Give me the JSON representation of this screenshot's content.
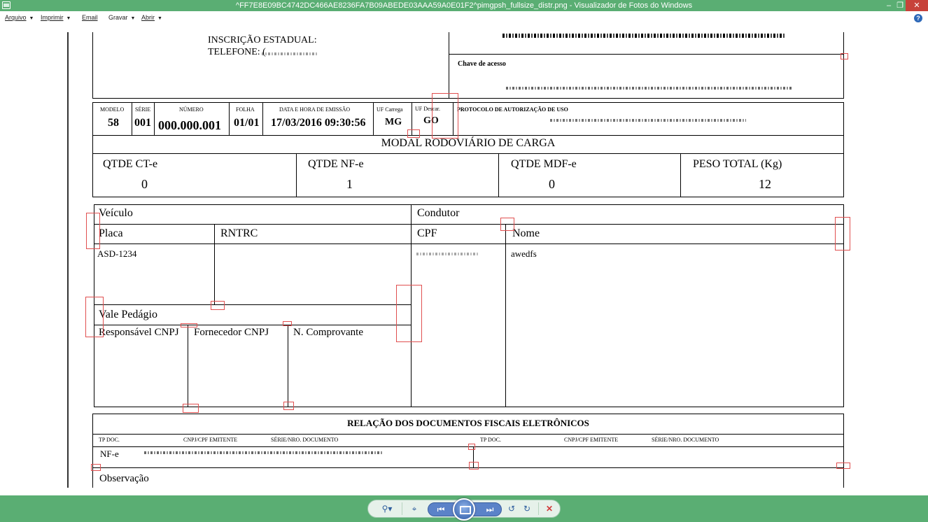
{
  "window": {
    "title": "^FF7E8E09BC4742DC466AE8236FA7B09ABEDE03AAA59A0E01F2^pimgpsh_fullsize_distr.png - Visualizador de Fotos do Windows",
    "minimize": "–",
    "restore": "❐",
    "close": "✕"
  },
  "menu": {
    "items": [
      {
        "label": "Arquivo",
        "has_dropdown": true
      },
      {
        "label": "Imprimir",
        "has_dropdown": true
      },
      {
        "label": "Email",
        "has_dropdown": false
      },
      {
        "label": "Gravar",
        "has_dropdown": true
      },
      {
        "label": "Abrir",
        "has_dropdown": true
      }
    ],
    "caret": "▼",
    "help": "?"
  },
  "document": {
    "header": {
      "inscricao": "INSCRIÇÃO ESTADUAL:",
      "telefone": "TELEFONE: (",
      "chave_label": "Chave de acesso",
      "protocolo_label": "PROTOCOLO DE AUTORIZAÇÃO DE USO"
    },
    "ids": {
      "modelo_label": "MODELO",
      "modelo": "58",
      "serie_label": "SÉRIE",
      "serie": "001",
      "numero_label": "NÚMERO",
      "numero": "000.000.001",
      "folha_label": "FOLHA",
      "folha": "01/01",
      "data_label": "DATA E HORA DE EMISSÃO",
      "data": "17/03/2016 09:30:56",
      "uf_carrega_label": "UF Carrega",
      "uf_carrega": "MG",
      "uf_descar_label": "UF Descar.",
      "uf_descar": "GO"
    },
    "modal_title": "MODAL RODOVIÁRIO DE CARGA",
    "totals": {
      "cte_label": "QTDE CT-e",
      "cte": "0",
      "nfe_label": "QTDE NF-e",
      "nfe": "1",
      "mdfe_label": "QTDE MDF-e",
      "mdfe": "0",
      "peso_label": "PESO TOTAL (Kg)",
      "peso": "12"
    },
    "veiculo": {
      "title": "Veículo",
      "placa_label": "Placa",
      "rntrc_label": "RNTRC",
      "placa": "ASD-1234"
    },
    "condutor": {
      "title": "Condutor",
      "cpf_label": "CPF",
      "nome_label": "Nome",
      "nome": "awedfs"
    },
    "vale": {
      "title": "Vale Pedágio",
      "resp_label": "Responsável CNPJ",
      "forn_label": "Fornecedor CNPJ",
      "comp_label": "N. Comprovante"
    },
    "relacao": {
      "title": "RELAÇÃO DOS DOCUMENTOS FISCAIS ELETRÔNICOS",
      "columns": [
        "TP DOC.",
        "CNPJ/CPF EMITENTE",
        "SÉRIE/NRO. DOCUMENTO"
      ],
      "first_row_type": "NF-e"
    },
    "observacao": "Observação"
  },
  "toolbar": {
    "zoom_icon": "magnifier-icon",
    "fit_icon": "actual-size-icon",
    "prev_icon": "previous-icon",
    "slideshow_icon": "slideshow-icon",
    "next_icon": "next-icon",
    "rotate_left_icon": "rotate-counterclockwise-icon",
    "rotate_right_icon": "rotate-clockwise-icon",
    "delete_icon": "delete-icon"
  },
  "colors": {
    "chrome": "#5aae73",
    "annotation_box": "#e05050",
    "delete": "#d23a3a"
  }
}
